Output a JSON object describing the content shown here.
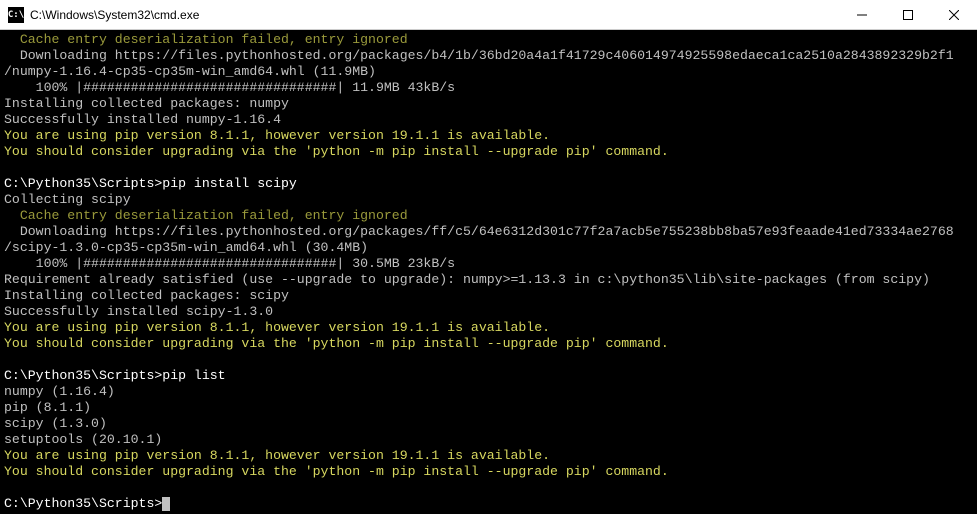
{
  "window": {
    "title": "C:\\Windows\\System32\\cmd.exe",
    "icon_label": "C:\\"
  },
  "lines": [
    {
      "cls": "c-olive",
      "indent": "  ",
      "text": "Cache entry deserialization failed, entry ignored"
    },
    {
      "cls": "c-white",
      "indent": "  ",
      "text": "Downloading https://files.pythonhosted.org/packages/b4/1b/36bd20a4a1f41729c406014974925598edaeca1ca2510a2843892329b2f1"
    },
    {
      "cls": "c-white",
      "indent": "",
      "text": "/numpy-1.16.4-cp35-cp35m-win_amd64.whl (11.9MB)"
    },
    {
      "cls": "c-white",
      "indent": "    ",
      "text": "100% |################################| 11.9MB 43kB/s"
    },
    {
      "cls": "c-white",
      "indent": "",
      "text": "Installing collected packages: numpy"
    },
    {
      "cls": "c-white",
      "indent": "",
      "text": "Successfully installed numpy-1.16.4"
    },
    {
      "cls": "c-yellow",
      "indent": "",
      "text": "You are using pip version 8.1.1, however version 19.1.1 is available."
    },
    {
      "cls": "c-yellow",
      "indent": "",
      "text": "You should consider upgrading via the 'python -m pip install --upgrade pip' command."
    },
    {
      "cls": "blank",
      "indent": "",
      "text": ""
    },
    {
      "cls": "prompt",
      "prompt": "C:\\Python35\\Scripts>",
      "cmd": "pip install scipy"
    },
    {
      "cls": "c-white",
      "indent": "",
      "text": "Collecting scipy"
    },
    {
      "cls": "c-olive",
      "indent": "  ",
      "text": "Cache entry deserialization failed, entry ignored"
    },
    {
      "cls": "c-white",
      "indent": "  ",
      "text": "Downloading https://files.pythonhosted.org/packages/ff/c5/64e6312d301c77f2a7acb5e755238bb8ba57e93feaade41ed73334ae2768"
    },
    {
      "cls": "c-white",
      "indent": "",
      "text": "/scipy-1.3.0-cp35-cp35m-win_amd64.whl (30.4MB)"
    },
    {
      "cls": "c-white",
      "indent": "    ",
      "text": "100% |################################| 30.5MB 23kB/s"
    },
    {
      "cls": "c-white",
      "indent": "",
      "text": "Requirement already satisfied (use --upgrade to upgrade): numpy>=1.13.3 in c:\\python35\\lib\\site-packages (from scipy)"
    },
    {
      "cls": "c-white",
      "indent": "",
      "text": "Installing collected packages: scipy"
    },
    {
      "cls": "c-white",
      "indent": "",
      "text": "Successfully installed scipy-1.3.0"
    },
    {
      "cls": "c-yellow",
      "indent": "",
      "text": "You are using pip version 8.1.1, however version 19.1.1 is available."
    },
    {
      "cls": "c-yellow",
      "indent": "",
      "text": "You should consider upgrading via the 'python -m pip install --upgrade pip' command."
    },
    {
      "cls": "blank",
      "indent": "",
      "text": ""
    },
    {
      "cls": "prompt",
      "prompt": "C:\\Python35\\Scripts>",
      "cmd": "pip list"
    },
    {
      "cls": "c-white",
      "indent": "",
      "text": "numpy (1.16.4)"
    },
    {
      "cls": "c-white",
      "indent": "",
      "text": "pip (8.1.1)"
    },
    {
      "cls": "c-white",
      "indent": "",
      "text": "scipy (1.3.0)"
    },
    {
      "cls": "c-white",
      "indent": "",
      "text": "setuptools (20.10.1)"
    },
    {
      "cls": "c-yellow",
      "indent": "",
      "text": "You are using pip version 8.1.1, however version 19.1.1 is available."
    },
    {
      "cls": "c-yellow",
      "indent": "",
      "text": "You should consider upgrading via the 'python -m pip install --upgrade pip' command."
    },
    {
      "cls": "blank",
      "indent": "",
      "text": ""
    },
    {
      "cls": "prompt-cursor",
      "prompt": "C:\\Python35\\Scripts>",
      "cmd": ""
    }
  ]
}
